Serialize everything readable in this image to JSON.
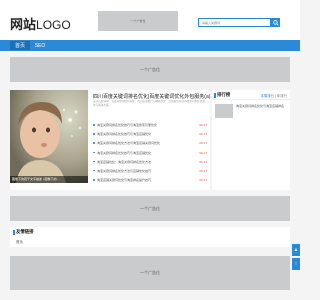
{
  "header": {
    "logo_main": "网站",
    "logo_sub": "LOGO",
    "ad_label": "一个广告位",
    "search_placeholder": "请输入关键词"
  },
  "nav": {
    "items": [
      "首页",
      "SEO"
    ]
  },
  "ads": {
    "banner_top": "一个广告位",
    "banner_mid": "一个广告位",
    "banner_bottom": "一个广告位"
  },
  "feature": {
    "title": "四川百度关键词排名优化|百度关键词优化外包服务(a)",
    "desc": "关注百度SEO、百度关键词排名优化、四川百度推广与网站优化，为您提供专业的搜索引擎优化服务与解决方案。",
    "hero_caption": "图像下的若干文字描述 | 图像下的..."
  },
  "news": [
    {
      "title": "淘宝关键词排名优化技巧与淘宝搜索引擎优化",
      "date": "06-17"
    },
    {
      "title": "淘宝关键词排名优化技巧与淘宝店铺优化",
      "date": "06-17"
    },
    {
      "title": "淘宝关键词排名优化方法与淘宝店铺关键词优化",
      "date": "06-17"
    },
    {
      "title": "淘宝关键词排名优化技巧与淘宝店铺优化",
      "date": "06-17"
    },
    {
      "title": "淘宝店铺优化：淘宝关键词排名优化方法",
      "date": "06-17"
    },
    {
      "title": "淘宝关键词排名优化方法与店铺优化技巧",
      "date": "06-17"
    },
    {
      "title": "淘宝店铺关键词优化与淘宝排名提升技巧",
      "date": "06-17"
    }
  ],
  "sidebar": {
    "title": "排行榜",
    "tabs": [
      "本周排行",
      "年排行"
    ],
    "item_text": "淘宝关键词排名优化与淘宝店铺排名"
  },
  "links": {
    "title": "友情链接",
    "items": [
      "首页"
    ]
  },
  "float": {
    "up": "▲",
    "top": "↑"
  },
  "colors": {
    "accent": "#2b8ad8",
    "ad_gray": "#c9cbcd",
    "date_red": "#e4504a"
  }
}
